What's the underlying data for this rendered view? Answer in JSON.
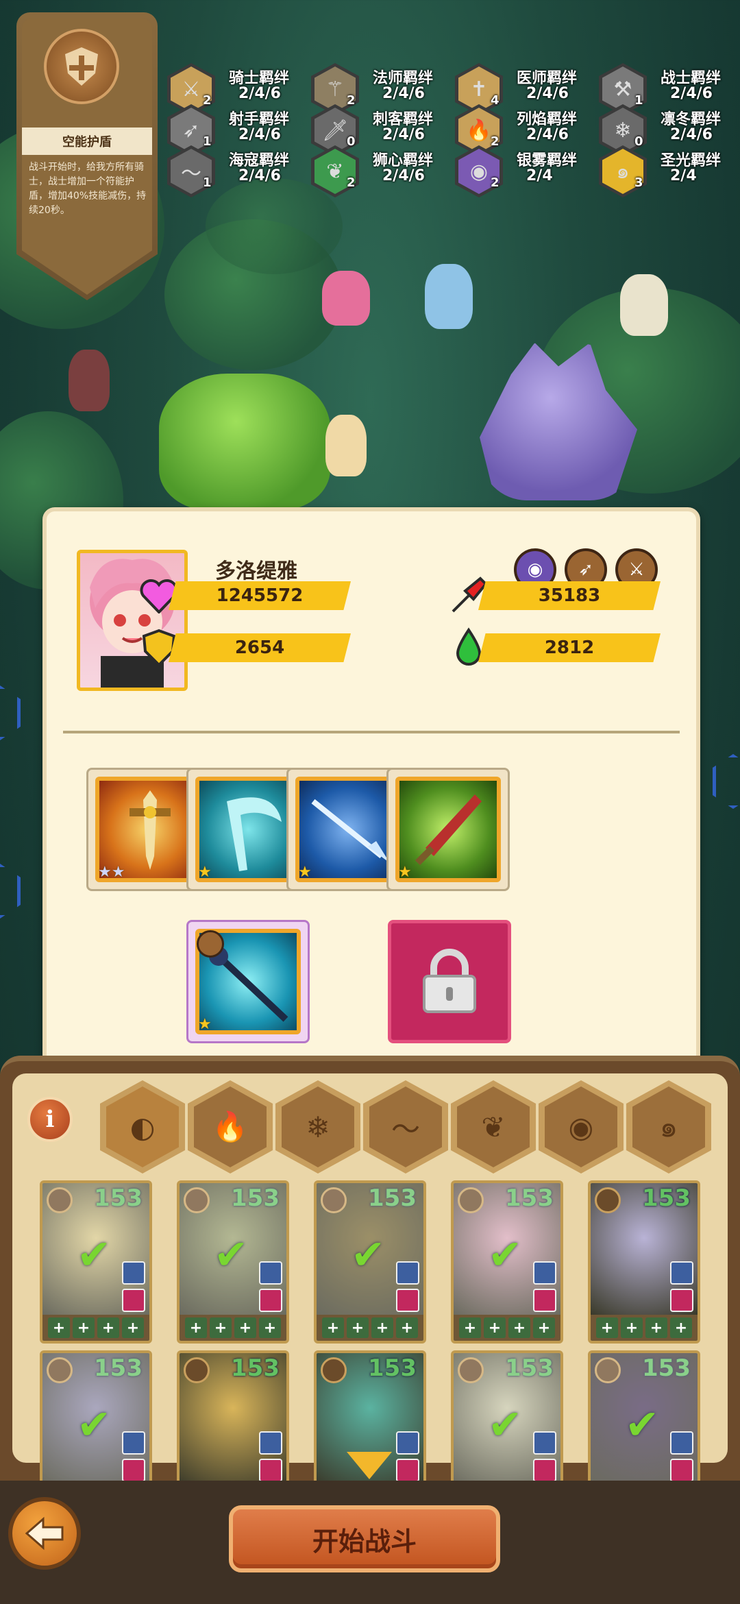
{
  "buff": {
    "title": "空能护盾",
    "description": "战斗开始时，给我方所有骑士，战士增加一个符能护盾，增加40%技能减伤，持续20秒。"
  },
  "bonds": [
    {
      "name": "骑士羁绊",
      "value": "2/4/6",
      "count": "2",
      "icon": "sword-icon",
      "color": "#c8a15a"
    },
    {
      "name": "法师羁绊",
      "value": "2/4/6",
      "count": "2",
      "icon": "staff-icon",
      "color": "#8e7f62"
    },
    {
      "name": "医师羁绊",
      "value": "2/4/6",
      "count": "4",
      "icon": "cross-icon",
      "color": "#c8a15a"
    },
    {
      "name": "战士羁绊",
      "value": "2/4/6",
      "count": "1",
      "icon": "axe-icon",
      "color": "#7a7a7a"
    },
    {
      "name": "射手羁绊",
      "value": "2/4/6",
      "count": "1",
      "icon": "bow-icon",
      "color": "#7a7a7a"
    },
    {
      "name": "刺客羁绊",
      "value": "2/4/6",
      "count": "0",
      "icon": "dagger-icon",
      "color": "#6a6a6a"
    },
    {
      "name": "列焰羁绊",
      "value": "2/4/6",
      "count": "2",
      "icon": "fire-icon",
      "color": "#c8a15a"
    },
    {
      "name": "凛冬羁绊",
      "value": "2/4/6",
      "count": "0",
      "icon": "snowflake-icon",
      "color": "#6a6a6a"
    },
    {
      "name": "海寇羁绊",
      "value": "2/4/6",
      "count": "1",
      "icon": "wave-icon",
      "color": "#6a6a6a"
    },
    {
      "name": "狮心羁绊",
      "value": "2/4/6",
      "count": "2",
      "icon": "leaf-icon",
      "color": "#3d9a4e"
    },
    {
      "name": "银雾羁绊",
      "value": "2/4",
      "count": "2",
      "icon": "eye-icon",
      "color": "#7b5ab3"
    },
    {
      "name": "圣光羁绊",
      "value": "2/4",
      "count": "3",
      "icon": "swirl-icon",
      "color": "#e4b52b"
    }
  ],
  "hero": {
    "name": "多洛缇雅",
    "hp": "1245572",
    "attack": "35183",
    "defense": "2654",
    "mana": "2812",
    "classes": [
      "eye-icon",
      "bow-icon",
      "sword-icon"
    ]
  },
  "equipment": [
    {
      "stars": "★★",
      "icon": "golden-sword-icon",
      "bg": "#d8731a"
    },
    {
      "stars": "★",
      "icon": "ice-scythe-icon",
      "bg": "#1e8b9b"
    },
    {
      "stars": "★",
      "icon": "trident-icon",
      "bg": "#1d5aa8"
    },
    {
      "stars": "★",
      "icon": "green-dagger-icon",
      "bg": "#4f8e1f"
    },
    {
      "stars": "★",
      "icon": "dark-staff-icon",
      "bg": "#1a95b3"
    }
  ],
  "filters": [
    "all-icon",
    "fire-icon",
    "snowflake-icon",
    "wave-icon",
    "leaf-icon",
    "eye-icon",
    "swirl-icon"
  ],
  "hero_slots": [
    {
      "level": "153",
      "checked": true,
      "palette": "#d9c98a"
    },
    {
      "level": "153",
      "checked": true,
      "palette": "#9aa06f"
    },
    {
      "level": "153",
      "checked": true,
      "palette": "#7a6a35"
    },
    {
      "level": "153",
      "checked": true,
      "palette": "#d9a9b8"
    },
    {
      "level": "153",
      "checked": false,
      "palette": "#b9b3d6"
    },
    {
      "level": "153",
      "checked": true,
      "palette": "#8e8aa8"
    },
    {
      "level": "153",
      "checked": false,
      "palette": "#d9b55a"
    },
    {
      "level": "153",
      "checked": false,
      "palette": "#5bb3a1"
    },
    {
      "level": "153",
      "checked": true,
      "palette": "#c9c7a8"
    },
    {
      "level": "153",
      "checked": true,
      "palette": "#4d3b5e"
    }
  ],
  "start_button": "开始战斗",
  "colors": {
    "accent": "#f8c31a",
    "panel": "#fdf5db",
    "button": "#c2541f"
  }
}
